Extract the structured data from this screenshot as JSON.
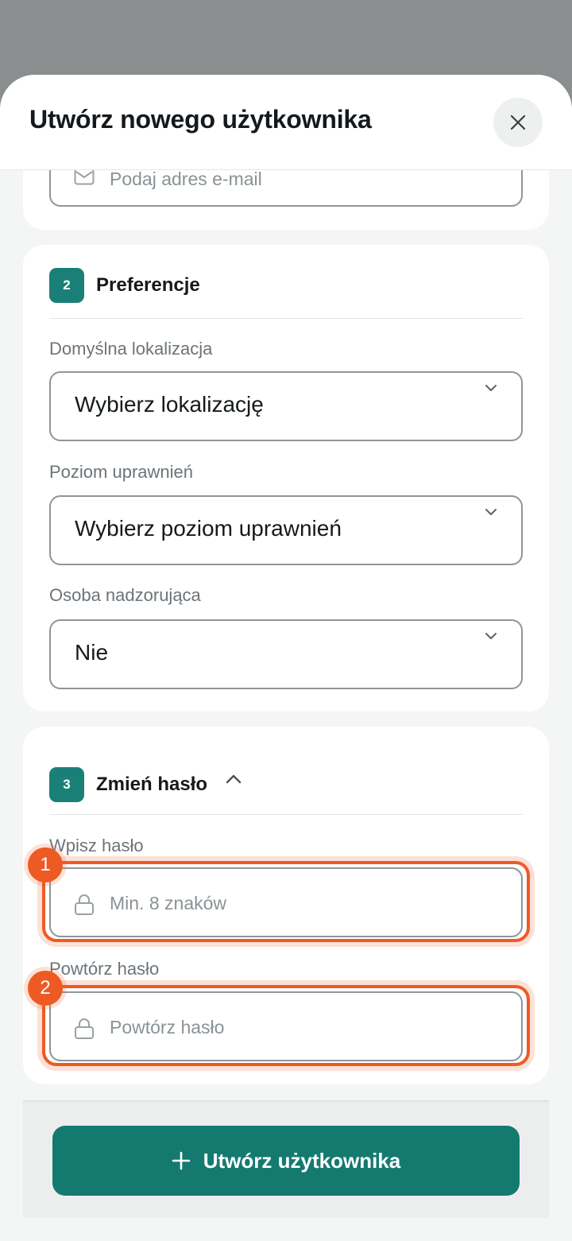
{
  "header": {
    "title": "Utwórz nowego użytkownika",
    "close_icon": "close-icon"
  },
  "email": {
    "placeholder": "Podaj adres e-mail",
    "icon": "mail-icon"
  },
  "preferences": {
    "step": "2",
    "title": "Preferencje",
    "location": {
      "label": "Domyślna lokalizacja",
      "value": "Wybierz lokalizację"
    },
    "permission": {
      "label": "Poziom uprawnień",
      "value": "Wybierz poziom uprawnień"
    },
    "supervisor": {
      "label": "Osoba nadzorująca",
      "value": "Nie"
    }
  },
  "password": {
    "step": "3",
    "title": "Zmień hasło",
    "toggle_icon": "chevron-up-icon",
    "new": {
      "label": "Wpisz hasło",
      "placeholder": "Min. 8 znaków",
      "icon": "lock-icon"
    },
    "repeat": {
      "label": "Powtórz hasło",
      "placeholder": "Powtórz hasło",
      "icon": "lock-icon"
    }
  },
  "annotations": {
    "first": "1",
    "second": "2",
    "color": "#ee5a24"
  },
  "footer": {
    "submit_label": "Utwórz użytkownika",
    "submit_icon": "plus-icon"
  },
  "colors": {
    "primary": "#147a70",
    "badge": "#1a8077",
    "highlight": "#ee5a24"
  }
}
